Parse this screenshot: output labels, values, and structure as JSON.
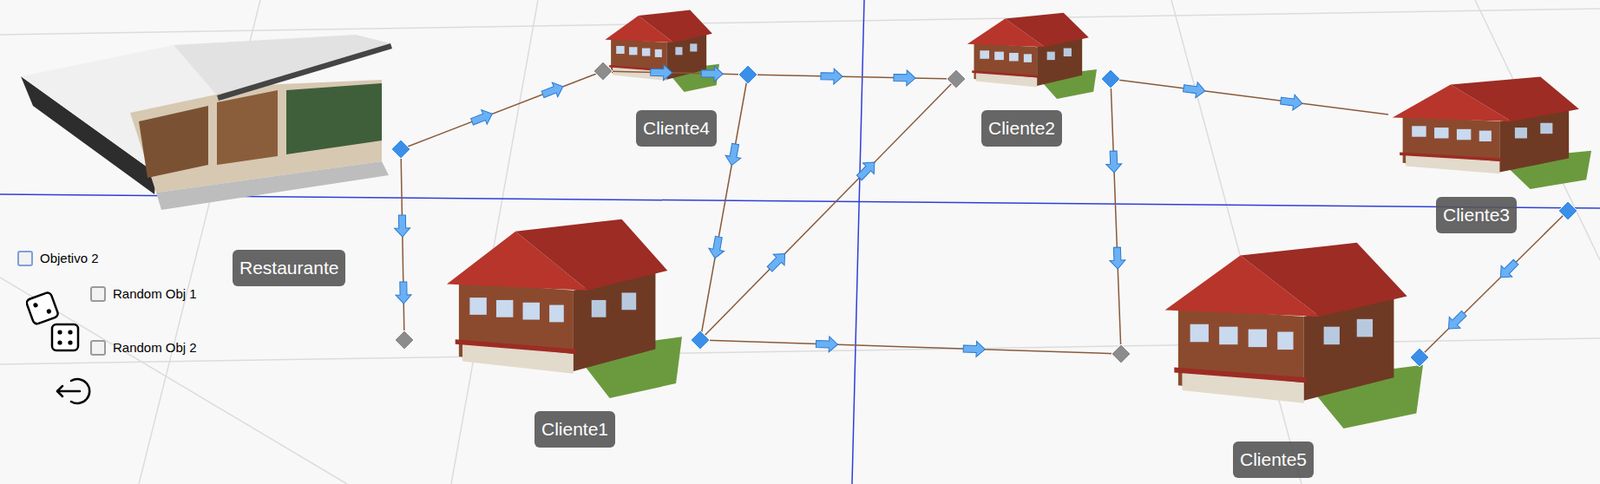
{
  "scene": {
    "labels": [
      "Restaurante",
      "Cliente4",
      "Cliente2",
      "Cliente3",
      "Cliente1",
      "Cliente5"
    ],
    "nodes": [
      {
        "color": "#3b8fe8"
      },
      {
        "color": "#8c8c8c"
      },
      {
        "color": "#3b8fe8"
      },
      {
        "color": "#8c8c8c"
      },
      {
        "color": "#3b8fe8"
      },
      {
        "color": "#3b8fe8"
      },
      {
        "color": "#3b8fe8"
      },
      {
        "color": "#3b8fe8"
      },
      {
        "color": "#8c8c8c"
      },
      {
        "color": "#8c8c8c"
      }
    ]
  },
  "controls": {
    "checkboxes": [
      {
        "label": "Objetivo 2",
        "checked": false,
        "focused": true
      },
      {
        "label": "Random Obj 1",
        "checked": false,
        "focused": false
      },
      {
        "label": "Random Obj 2",
        "checked": false,
        "focused": false
      }
    ]
  }
}
